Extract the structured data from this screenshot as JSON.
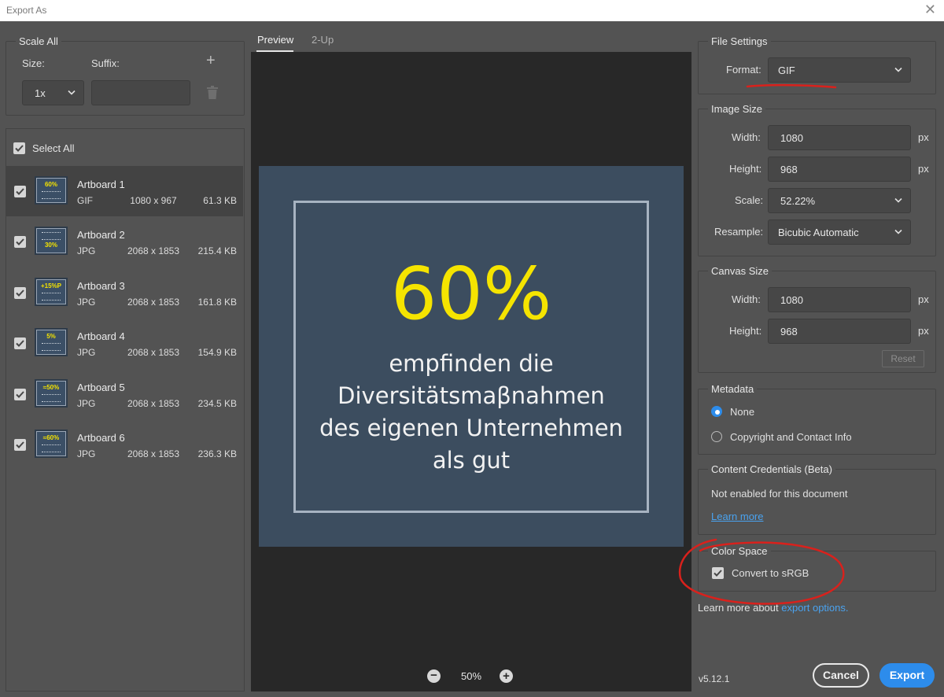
{
  "window": {
    "title": "Export As",
    "close_glyph": "✕"
  },
  "scale_all": {
    "legend": "Scale All",
    "size_label": "Size:",
    "suffix_label": "Suffix:",
    "size_value": "1x",
    "suffix_value": "",
    "add_glyph": "+"
  },
  "select_all_label": "Select All",
  "artboards": [
    {
      "name": "Artboard 1",
      "format": "GIF",
      "dims": "1080 x 967",
      "size": "61.3 KB",
      "thumb": "60%",
      "selected": true
    },
    {
      "name": "Artboard 2",
      "format": "JPG",
      "dims": "2068 x 1853",
      "size": "215.4 KB",
      "thumb": "30%",
      "selected": false
    },
    {
      "name": "Artboard 3",
      "format": "JPG",
      "dims": "2068 x 1853",
      "size": "161.8 KB",
      "thumb": "+15%P",
      "selected": false
    },
    {
      "name": "Artboard 4",
      "format": "JPG",
      "dims": "2068 x 1853",
      "size": "154.9 KB",
      "thumb": "5%",
      "selected": false
    },
    {
      "name": "Artboard 5",
      "format": "JPG",
      "dims": "2068 x 1853",
      "size": "234.5 KB",
      "thumb": "≈50%",
      "selected": false
    },
    {
      "name": "Artboard 6",
      "format": "JPG",
      "dims": "2068 x 1853",
      "size": "236.3 KB",
      "thumb": "≈60%",
      "selected": false
    }
  ],
  "tabs": {
    "preview": "Preview",
    "two_up": "2-Up"
  },
  "artwork": {
    "big": "60%",
    "line1": "empfinden die",
    "line2": "Diversitätsmaβnahmen",
    "line3": "des eigenen Unternehmen",
    "line4": "als gut"
  },
  "zoom": {
    "value": "50%",
    "minus": "−",
    "plus": "+"
  },
  "file_settings": {
    "legend": "File Settings",
    "format_label": "Format:",
    "format_value": "GIF"
  },
  "image_size": {
    "legend": "Image Size",
    "width_label": "Width:",
    "width_value": "1080",
    "height_label": "Height:",
    "height_value": "968",
    "scale_label": "Scale:",
    "scale_value": "52.22%",
    "resample_label": "Resample:",
    "resample_value": "Bicubic Automatic",
    "unit": "px"
  },
  "canvas_size": {
    "legend": "Canvas Size",
    "width_label": "Width:",
    "width_value": "1080",
    "height_label": "Height:",
    "height_value": "968",
    "unit": "px",
    "reset_label": "Reset"
  },
  "metadata": {
    "legend": "Metadata",
    "opt_none": "None",
    "opt_copyright": "Copyright and Contact Info"
  },
  "content_credentials": {
    "legend": "Content Credentials (Beta)",
    "status": "Not enabled for this document",
    "learn_more": "Learn more"
  },
  "color_space": {
    "legend": "Color Space",
    "convert_label": "Convert to sRGB"
  },
  "learn_more_line": {
    "prefix": "Learn more about ",
    "link": "export options."
  },
  "version": "v5.12.1",
  "buttons": {
    "cancel": "Cancel",
    "export": "Export"
  },
  "colors": {
    "accent": "#2d8ceb",
    "art_bg": "#3c4d5f",
    "art_yellow": "#f5e400",
    "annotation_red": "#d9211c"
  }
}
